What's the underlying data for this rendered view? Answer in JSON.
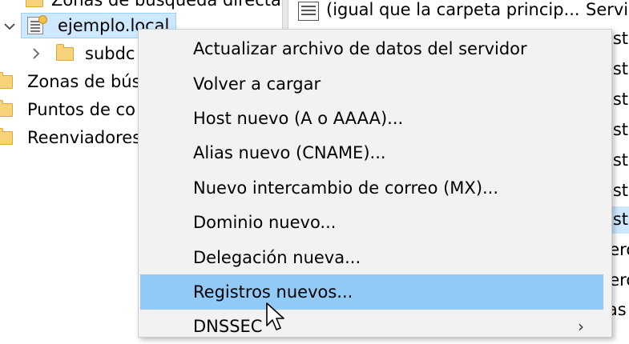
{
  "tree": {
    "items": [
      {
        "label": "Zonas de búsqueda directa",
        "chevron": "",
        "icon": "folder"
      },
      {
        "label": "ejemplo.local",
        "chevron": "expanded",
        "icon": "zone",
        "selected": true
      },
      {
        "label": "subdc",
        "chevron": "collapsed",
        "icon": "folder"
      },
      {
        "label": "Zonas de bús",
        "chevron": "",
        "icon": "folder"
      },
      {
        "label": "Puntos de co",
        "chevron": "",
        "icon": "folder"
      },
      {
        "label": "Reenviadores",
        "chevron": "",
        "icon": "folder"
      }
    ]
  },
  "list": {
    "first_row": {
      "name": "(igual que la carpeta princip...",
      "type": "Servic"
    },
    "fragments": [
      "ost",
      "ost",
      "ost",
      "ost",
      "ost",
      "ost",
      "ost",
      "tero",
      "tero",
      "ias"
    ]
  },
  "context_menu": {
    "items": [
      {
        "label": "Actualizar archivo de datos del servidor"
      },
      {
        "label": "Volver a cargar"
      },
      {
        "label": "Host nuevo (A o AAAA)..."
      },
      {
        "label": "Alias nuevo (CNAME)..."
      },
      {
        "label": "Nuevo intercambio de correo (MX)..."
      },
      {
        "label": "Dominio nuevo..."
      },
      {
        "label": "Delegación nueva..."
      },
      {
        "label": "Registros nuevos..."
      },
      {
        "label": "DNSSEC",
        "submenu_arrow": "›"
      }
    ],
    "highlighted_index": 7
  },
  "colors": {
    "menu_background": "#f2f2f2",
    "menu_hover": "#91c9f7",
    "tree_selection": "#cde8ff",
    "folder": "#f6d27a"
  }
}
